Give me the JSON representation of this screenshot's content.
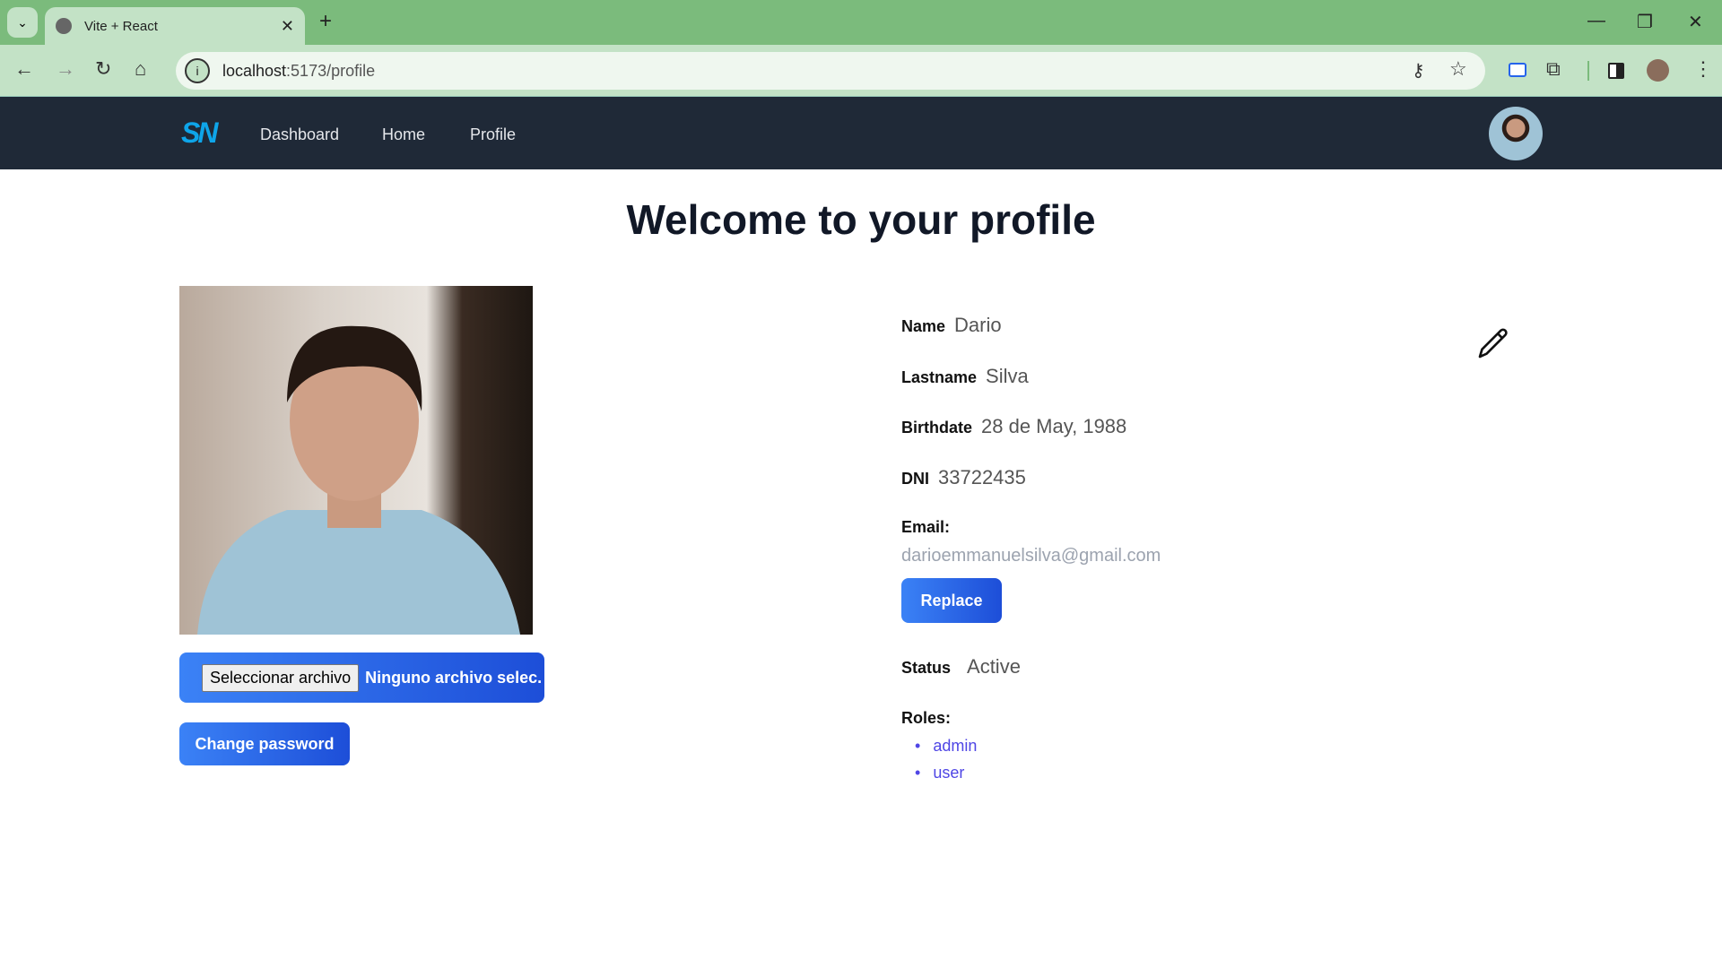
{
  "browser": {
    "tab_title": "Vite + React",
    "url_host": "localhost",
    "url_path": ":5173/profile"
  },
  "nav": {
    "logo": "SN",
    "links": [
      "Dashboard",
      "Home",
      "Profile"
    ]
  },
  "page": {
    "title": "Welcome to your profile"
  },
  "upload": {
    "button": "Seleccionar archivo",
    "status": "Ninguno archivo selec."
  },
  "change_password": "Change password",
  "profile": {
    "name_label": "Name",
    "name": "Dario",
    "lastname_label": "Lastname",
    "lastname": "Silva",
    "birthdate_label": "Birthdate",
    "birthdate": "28 de May, 1988",
    "dni_label": "DNI",
    "dni": "33722435",
    "email_label": "Email:",
    "email": "darioemmanuelsilva@gmail.com",
    "replace": "Replace",
    "status_label": "Status",
    "status": "Active",
    "roles_label": "Roles:",
    "roles": [
      "admin",
      "user"
    ]
  }
}
